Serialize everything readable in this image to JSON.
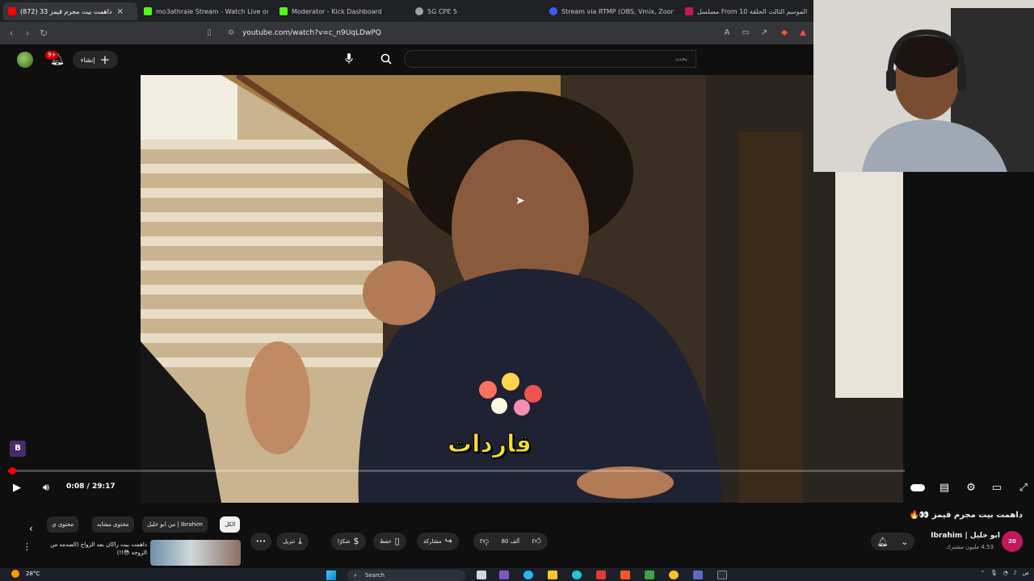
{
  "browser": {
    "tabs": [
      {
        "title": "(872) داهمت بيت مجرم قيمز 33",
        "favicon": "youtube-icon",
        "color": "#ff0000",
        "active": true
      },
      {
        "title": "mo3athraie Stream - Watch Live on K",
        "favicon": "kick-icon",
        "color": "#53fc18",
        "active": false
      },
      {
        "title": "Moderator - Kick Dashboard",
        "favicon": "kick-icon",
        "color": "#53fc18",
        "active": false
      },
      {
        "title": "5G CPE 5",
        "favicon": "globe-icon",
        "color": "#9aa0a6",
        "active": false
      },
      {
        "title": "Stream via RTMP (OBS, Vmix, Zoom)",
        "favicon": "restream-icon",
        "color": "#3b5cff",
        "active": false
      },
      {
        "title": "مسلسل From الموسم الثالث الحلقة 10",
        "favicon": "film-icon",
        "color": "#c2185b",
        "active": false
      }
    ],
    "tab_close": "×",
    "url": "youtube.com/watch?v=c_n9UqLDwPQ"
  },
  "youtube_header": {
    "notifications_badge": "9+",
    "create_label": "إنشاء",
    "search_placeholder": "بحث"
  },
  "player": {
    "caption": "قاردات",
    "time_current": "0:08",
    "time_total": "29:17",
    "time_display": "0:08 / 29:17",
    "progress_fraction": 0.0046,
    "channel_watermark": "B"
  },
  "video": {
    "title": "داهمت بيت مجرم قيمز 👀🔥",
    "channel_name": "ابو خليل | Ibrahim",
    "subscribers": "4.53 مليون مشترك",
    "likes": "80 ألف"
  },
  "actions": {
    "share": "مشاركة",
    "save": "حفظ",
    "thanks": "شكرًا",
    "download": "تنزيل",
    "more": "•••"
  },
  "chips": {
    "all": "الكل",
    "from_channel": "من ابو خليل | Ibrahim",
    "similar": "محتوى مشابه",
    "partial": "محتوى ي"
  },
  "recommendation": {
    "title": "داهمت بيت راكان بعد الزواج (الصدمه من الزوجه 😳!!)"
  },
  "taskbar": {
    "temperature": "28°C",
    "search_label": "Search",
    "tray_text": "ص"
  }
}
